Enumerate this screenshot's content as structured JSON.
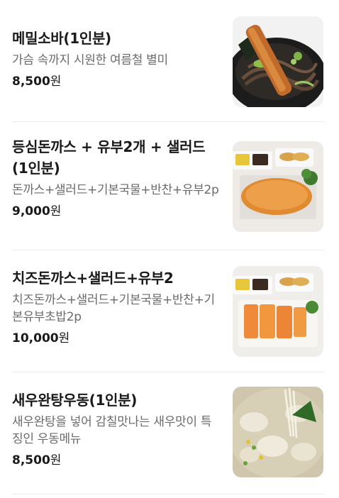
{
  "menu": {
    "items": [
      {
        "name": "메밀소바(1인분)",
        "description": "가슴 속까지 시원한 여름철 별미",
        "price": "8,500",
        "currency": "원",
        "image_icon": "buckwheat-soba-photo"
      },
      {
        "name": "등심돈까스 + 유부2개 + 샐러드(1인분)",
        "description": "돈까스+샐러드+기본국물+반찬+유부2p",
        "price": "9,000",
        "currency": "원",
        "image_icon": "pork-cutlet-set-photo"
      },
      {
        "name": "치즈돈까스+샐러드+유부2",
        "description": "치즈돈까스+샐러드+기본국물+반찬+기본유부초밥2p",
        "price": "10,000",
        "currency": "원",
        "image_icon": "cheese-cutlet-set-photo"
      },
      {
        "name": "새우완탕우동(1인분)",
        "description": "새우완탕을 넣어 감칠맛나는 새우맛이 특징인 우동메뉴",
        "price": "8,500",
        "currency": "원",
        "image_icon": "shrimp-wonton-udon-photo"
      }
    ]
  },
  "colors": {
    "title": "#1a1a1a",
    "description": "#6b6b6b",
    "divider": "#ececec"
  }
}
